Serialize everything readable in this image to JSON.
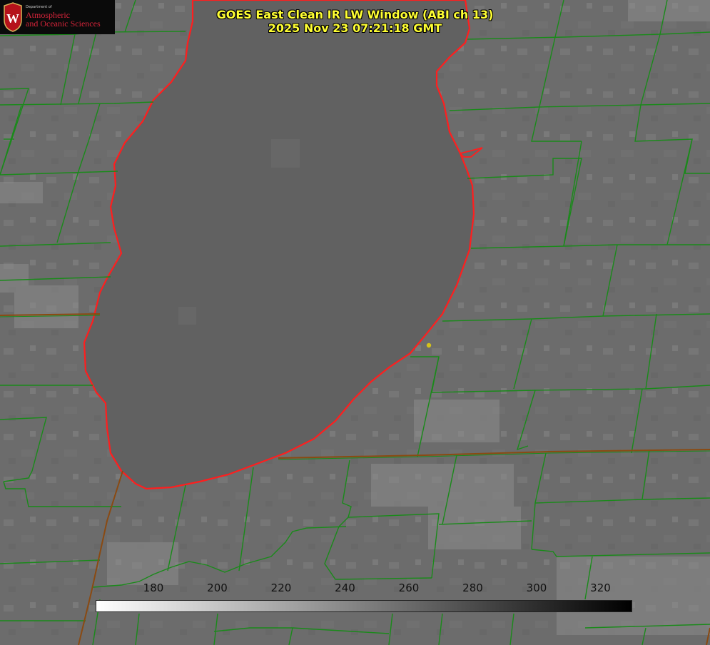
{
  "header": {
    "title_line1": "GOES East Clean IR LW Window (ABI ch 13)",
    "title_line2": "2025 Nov 23 07:21:18 GMT"
  },
  "logo": {
    "department": "Department of",
    "line1": "Atmospheric",
    "line2": "and Oceanic Sciences",
    "emblem_letter": "W"
  },
  "colorbar": {
    "ticks": [
      "180",
      "200",
      "220",
      "240",
      "260",
      "280",
      "300",
      "320"
    ]
  },
  "colors": {
    "title": "#ffff33",
    "county_lines": "#1a8a1a",
    "state_lines": "#8a4a12",
    "coastline": "#ff1e1e",
    "marker": "#d4c21a",
    "logo_text": "#d6243a"
  }
}
